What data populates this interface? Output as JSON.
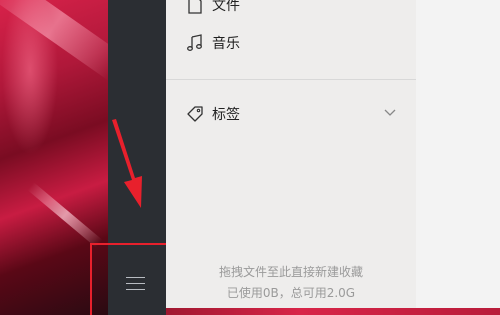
{
  "nav": {
    "files_label": "文件",
    "music_label": "音乐",
    "tags_label": "标签"
  },
  "footer": {
    "drag_hint": "拖拽文件至此直接新建收藏",
    "storage": "已使用0B，总可用2.0G"
  },
  "icons": {
    "files": "file-icon",
    "music": "music-note-icon",
    "tags": "tag-icon",
    "expand": "chevron-down-icon",
    "menu": "hamburger-menu-icon"
  },
  "colors": {
    "annotation": "#e8202c",
    "rail": "#2b2e33",
    "panel": "#eeedec"
  }
}
